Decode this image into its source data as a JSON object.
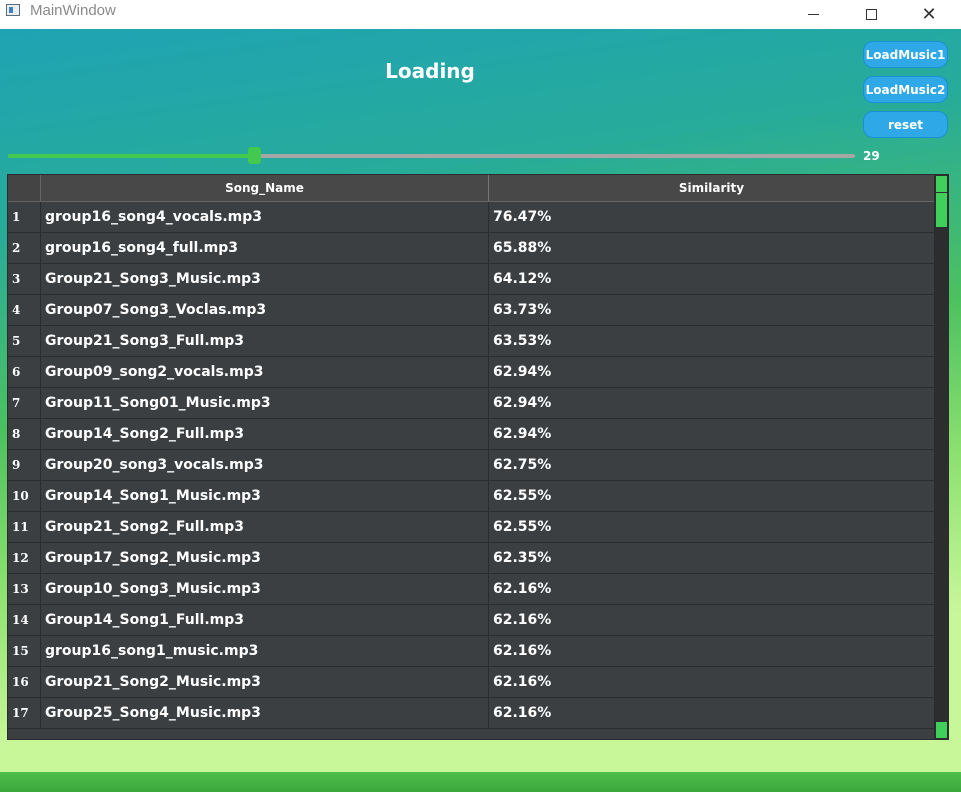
{
  "window": {
    "title": "MainWindow",
    "controls": {
      "minimize": "—",
      "maximize": "☐",
      "close": "✕"
    }
  },
  "header": {
    "title": "Loading"
  },
  "buttons": {
    "load_music_1": "LoadMusic1",
    "load_music_2": "LoadMusic2",
    "reset": "reset"
  },
  "slider": {
    "value": "29",
    "fill_fraction": 0.29
  },
  "table": {
    "columns": [
      "Song_Name",
      "Similarity"
    ],
    "rows": [
      {
        "index": "1",
        "name": "group16_song4_vocals.mp3",
        "similarity": "76.47%"
      },
      {
        "index": "2",
        "name": "group16_song4_full.mp3",
        "similarity": "65.88%"
      },
      {
        "index": "3",
        "name": "Group21_Song3_Music.mp3",
        "similarity": "64.12%"
      },
      {
        "index": "4",
        "name": "Group07_Song3_Voclas.mp3",
        "similarity": "63.73%"
      },
      {
        "index": "5",
        "name": "Group21_Song3_Full.mp3",
        "similarity": "63.53%"
      },
      {
        "index": "6",
        "name": "Group09_song2_vocals.mp3",
        "similarity": "62.94%"
      },
      {
        "index": "7",
        "name": "Group11_Song01_Music.mp3",
        "similarity": "62.94%"
      },
      {
        "index": "8",
        "name": "Group14_Song2_Full.mp3",
        "similarity": "62.94%"
      },
      {
        "index": "9",
        "name": "Group20_song3_vocals.mp3",
        "similarity": "62.75%"
      },
      {
        "index": "10",
        "name": "Group14_Song1_Music.mp3",
        "similarity": "62.55%"
      },
      {
        "index": "11",
        "name": "Group21_Song2_Full.mp3",
        "similarity": "62.55%"
      },
      {
        "index": "12",
        "name": "Group17_Song2_Music.mp3",
        "similarity": "62.35%"
      },
      {
        "index": "13",
        "name": "Group10_Song3_Music.mp3",
        "similarity": "62.16%"
      },
      {
        "index": "14",
        "name": "Group14_Song1_Full.mp3",
        "similarity": "62.16%"
      },
      {
        "index": "15",
        "name": "group16_song1_music.mp3",
        "similarity": "62.16%"
      },
      {
        "index": "16",
        "name": "Group21_Song2_Music.mp3",
        "similarity": "62.16%"
      },
      {
        "index": "17",
        "name": "Group25_Song4_Music.mp3",
        "similarity": "62.16%"
      }
    ]
  },
  "colors": {
    "accent_green": "#43c94e",
    "button_blue": "#2fa8e8",
    "table_bg": "#3b3f42"
  }
}
